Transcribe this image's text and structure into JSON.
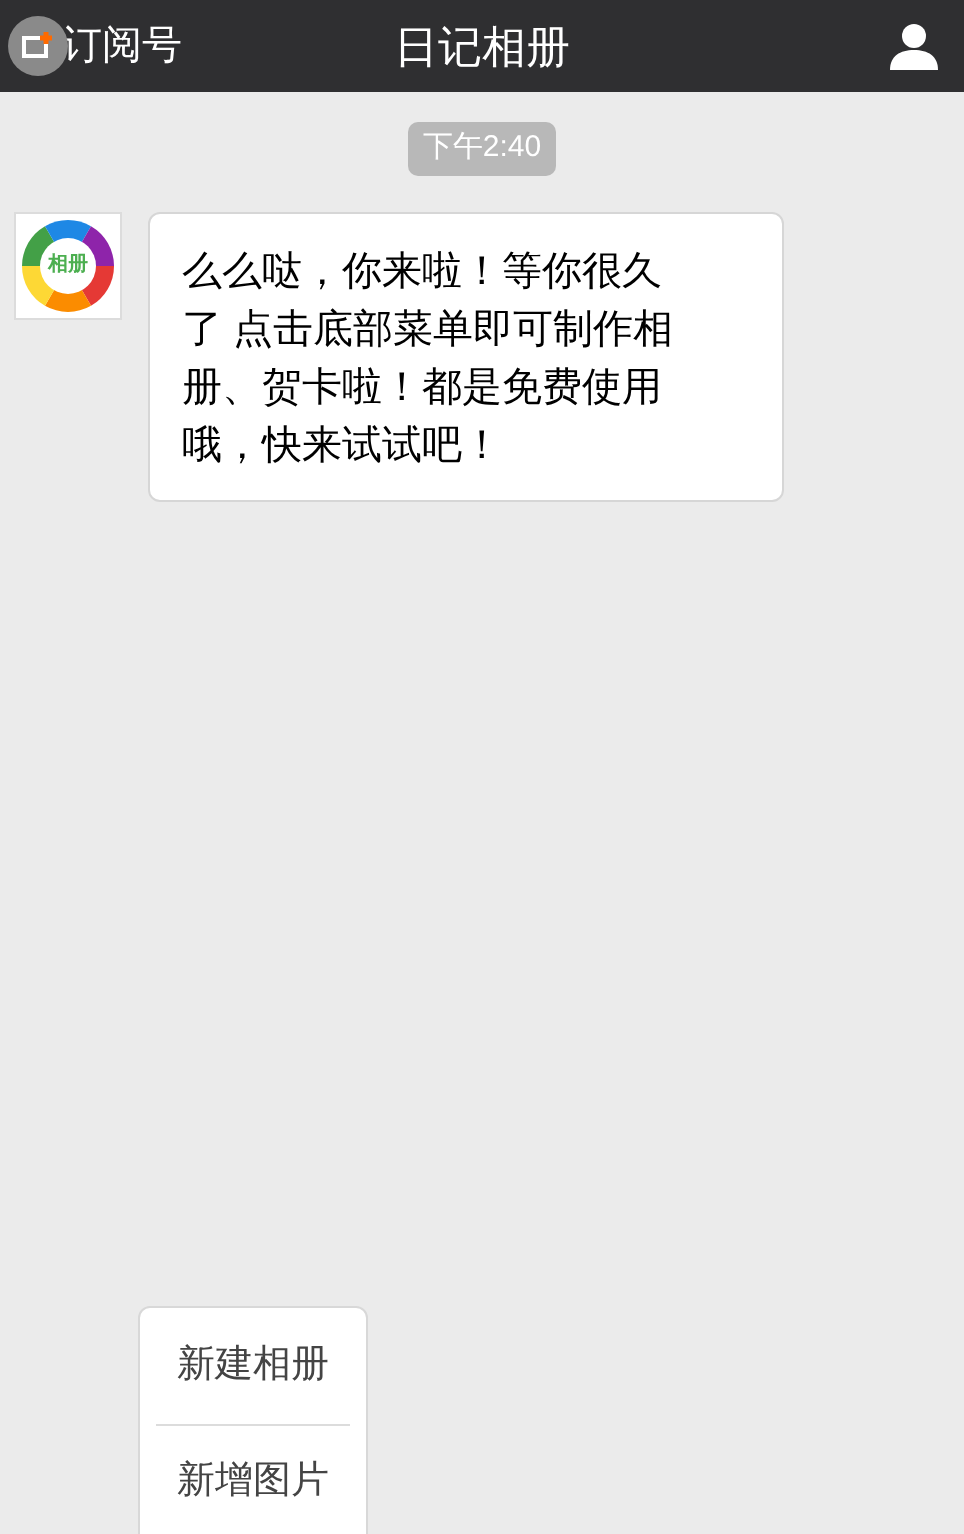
{
  "header": {
    "back_label": "订阅号",
    "title": "日记相册"
  },
  "timestamp": "下午2:40",
  "message": {
    "avatar_text": "相册",
    "lines": [
      "么么哒，你来啦！等你很久",
      "了 点击底部菜单即可制作相",
      "册、贺卡啦！都是免费使用",
      "哦，快来试试吧！"
    ]
  },
  "menu": {
    "items": [
      "新建相册",
      "新增图片"
    ]
  }
}
